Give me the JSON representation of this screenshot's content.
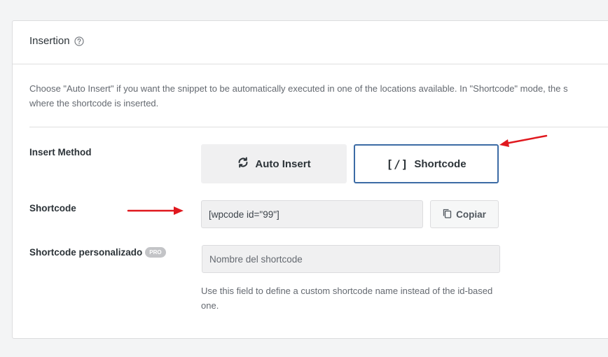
{
  "panel": {
    "title": "Insertion",
    "help_icon": "question-circle-icon",
    "description_line1": "Choose \"Auto Insert\" if you want the snippet to be automatically executed in one of the locations available. In \"Shortcode\" mode, the s",
    "description_line2": "where the shortcode is inserted."
  },
  "insert_method": {
    "label": "Insert Method",
    "auto_insert_label": "Auto Insert",
    "auto_insert_icon": "refresh-icon",
    "shortcode_label": "Shortcode",
    "shortcode_icon_text": "[/]",
    "selected": "Shortcode"
  },
  "shortcode": {
    "label": "Shortcode",
    "value": "[wpcode id=\"99\"]",
    "copy_label": "Copiar",
    "copy_icon": "copy-icon"
  },
  "custom_shortcode": {
    "label": "Shortcode personalizado",
    "badge": "PRO",
    "placeholder": "Nombre del shortcode",
    "hint": "Use this field to define a custom shortcode name instead of the id-based one."
  },
  "colors": {
    "accent": "#3c6ba5",
    "annotation_arrow": "#e0181e"
  }
}
